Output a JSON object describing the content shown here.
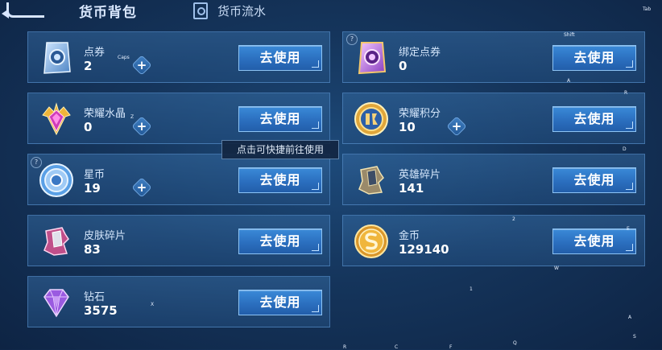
{
  "topbar": {
    "title": "货币背包",
    "flow_tab": "货币流水",
    "tab_hint": "Tab"
  },
  "tooltip": "点击可快捷前往使用",
  "button_label": "去使用",
  "plus_symbol": "+",
  "help_symbol": "?",
  "currencies": [
    {
      "name": "点券",
      "count": "2",
      "icon": "ticket-icon",
      "has_plus": true
    },
    {
      "name": "绑定点券",
      "count": "0",
      "icon": "bound-ticket-icon",
      "has_plus": false
    },
    {
      "name": "荣耀水晶",
      "count": "0",
      "icon": "crystal-icon",
      "has_plus": true
    },
    {
      "name": "荣耀积分",
      "count": "10",
      "icon": "honor-points-icon",
      "has_plus": true
    },
    {
      "name": "星币",
      "count": "19",
      "icon": "star-coin-icon",
      "has_plus": true
    },
    {
      "name": "英雄碎片",
      "count": "141",
      "icon": "hero-fragment-icon",
      "has_plus": false
    },
    {
      "name": "皮肤碎片",
      "count": "83",
      "icon": "skin-fragment-icon",
      "has_plus": false
    },
    {
      "name": "金币",
      "count": "129140",
      "icon": "gold-coin-icon",
      "has_plus": false
    },
    {
      "name": "钻石",
      "count": "3575",
      "icon": "diamond-icon",
      "has_plus": false
    }
  ],
  "key_hints": [
    "Shift",
    "Caps",
    "A",
    "R",
    "Z",
    "D",
    "2",
    "E",
    "W",
    "1",
    "X",
    "A",
    "S",
    "R",
    "C",
    "F",
    "Q"
  ]
}
